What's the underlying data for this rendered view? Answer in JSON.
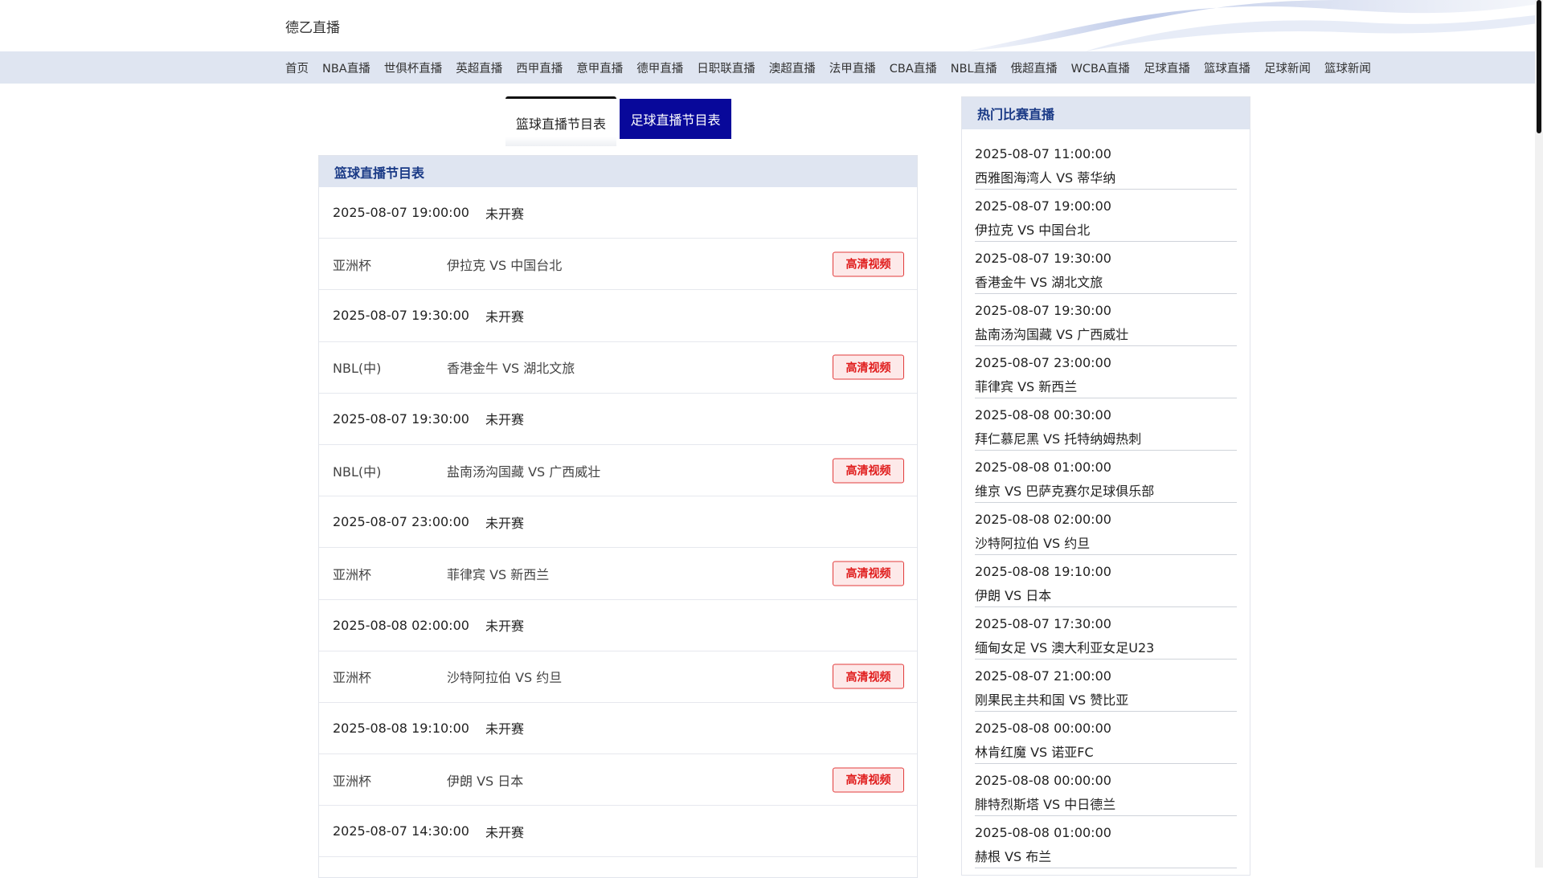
{
  "header": {
    "site_title": "德乙直播"
  },
  "nav": {
    "items": [
      "首页",
      "NBA直播",
      "世俱杯直播",
      "英超直播",
      "西甲直播",
      "意甲直播",
      "德甲直播",
      "日职联直播",
      "澳超直播",
      "法甲直播",
      "CBA直播",
      "NBL直播",
      "俄超直播",
      "WCBA直播",
      "足球直播",
      "篮球直播",
      "足球新闻",
      "篮球新闻"
    ]
  },
  "tabs": {
    "basketball": "篮球直播节目表",
    "football": "足球直播节目表"
  },
  "schedule": {
    "title": "篮球直播节目表",
    "hd_label": "高清视频",
    "games": [
      {
        "time": "2025-08-07 19:00:00",
        "status": "未开赛",
        "league": "亚洲杯",
        "match": "伊拉克 VS 中国台北"
      },
      {
        "time": "2025-08-07 19:30:00",
        "status": "未开赛",
        "league": "NBL(中)",
        "match": "香港金牛 VS 湖北文旅"
      },
      {
        "time": "2025-08-07 19:30:00",
        "status": "未开赛",
        "league": "NBL(中)",
        "match": "盐南汤沟国藏 VS 广西威壮"
      },
      {
        "time": "2025-08-07 23:00:00",
        "status": "未开赛",
        "league": "亚洲杯",
        "match": "菲律宾 VS 新西兰"
      },
      {
        "time": "2025-08-08 02:00:00",
        "status": "未开赛",
        "league": "亚洲杯",
        "match": "沙特阿拉伯 VS 约旦"
      },
      {
        "time": "2025-08-08 19:10:00",
        "status": "未开赛",
        "league": "亚洲杯",
        "match": "伊朗 VS 日本"
      },
      {
        "time": "2025-08-07 14:30:00",
        "status": "未开赛",
        "league": "",
        "match": ""
      }
    ]
  },
  "hot": {
    "title": "热门比赛直播",
    "items": [
      {
        "time": "2025-08-07 11:00:00",
        "match": "西雅图海湾人 VS 蒂华纳"
      },
      {
        "time": "2025-08-07 19:00:00",
        "match": "伊拉克 VS 中国台北"
      },
      {
        "time": "2025-08-07 19:30:00",
        "match": "香港金牛 VS 湖北文旅"
      },
      {
        "time": "2025-08-07 19:30:00",
        "match": "盐南汤沟国藏 VS 广西威壮"
      },
      {
        "time": "2025-08-07 23:00:00",
        "match": "菲律宾 VS 新西兰"
      },
      {
        "time": "2025-08-08 00:30:00",
        "match": "拜仁慕尼黑 VS 托特纳姆热刺"
      },
      {
        "time": "2025-08-08 01:00:00",
        "match": "维京 VS 巴萨克赛尔足球俱乐部"
      },
      {
        "time": "2025-08-08 02:00:00",
        "match": "沙特阿拉伯 VS 约旦"
      },
      {
        "time": "2025-08-08 19:10:00",
        "match": "伊朗 VS 日本"
      },
      {
        "time": "2025-08-07 17:30:00",
        "match": "缅甸女足 VS 澳大利亚女足U23"
      },
      {
        "time": "2025-08-07 21:00:00",
        "match": "刚果民主共和国 VS 赞比亚"
      },
      {
        "time": "2025-08-08 00:00:00",
        "match": "林肯红魔 VS 诺亚FC"
      },
      {
        "time": "2025-08-08 00:00:00",
        "match": "腓特烈斯塔 VS 中日德兰"
      },
      {
        "time": "2025-08-08 01:00:00",
        "match": "赫根 VS 布兰"
      }
    ]
  }
}
